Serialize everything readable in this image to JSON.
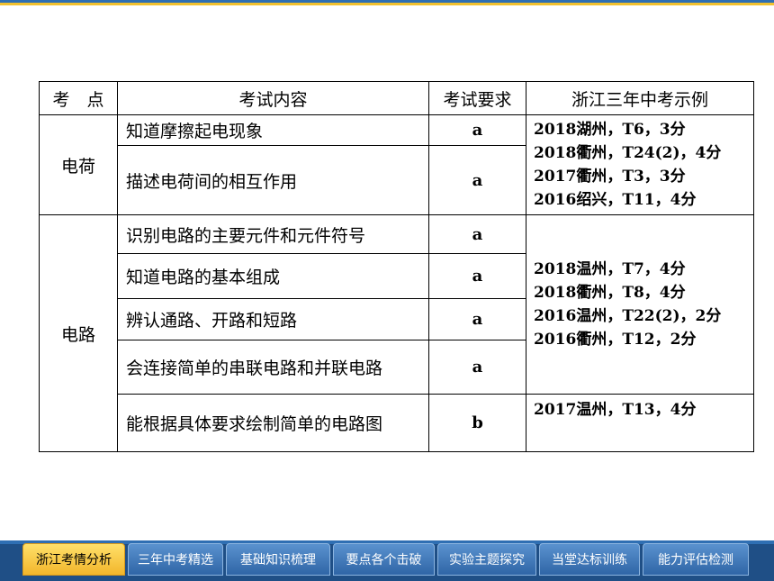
{
  "table": {
    "headers": [
      "考　点",
      "考试内容",
      "考试要求",
      "浙江三年中考示例"
    ],
    "groups": [
      {
        "topic": "电荷",
        "rows": [
          {
            "content": "知道摩擦起电现象",
            "req": "a"
          },
          {
            "content": "描述电荷间的相互作用",
            "req": "a"
          }
        ],
        "examples": [
          "2018湖州，T6，3分",
          "2018衢州，T24(2)，4分",
          "2017衢州，T3，3分",
          "2016绍兴，T11，4分"
        ]
      },
      {
        "topic": "电路",
        "rows": [
          {
            "content": "识别电路的主要元件和元件符号",
            "req": "a"
          },
          {
            "content": "知道电路的基本组成",
            "req": "a"
          },
          {
            "content": "辨认通路、开路和短路",
            "req": "a"
          },
          {
            "content": "会连接简单的串联电路和并联电路",
            "req": "a"
          },
          {
            "content": "能根据具体要求绘制简单的电路图",
            "req": "b"
          }
        ],
        "examples_main": [
          "2018温州，T7，4分",
          "2018衢州，T8，4分",
          "2016温州，T22(2)，2分",
          "2016衢州，T12，2分"
        ],
        "examples_last": [
          "2017温州，T13，4分"
        ]
      }
    ]
  },
  "nav": {
    "tabs": [
      "浙江考情分析",
      "三年中考精选",
      "基础知识梳理",
      "要点各个击破",
      "实验主题探究",
      "当堂达标训练",
      "能力评估检测"
    ],
    "active": 0
  }
}
